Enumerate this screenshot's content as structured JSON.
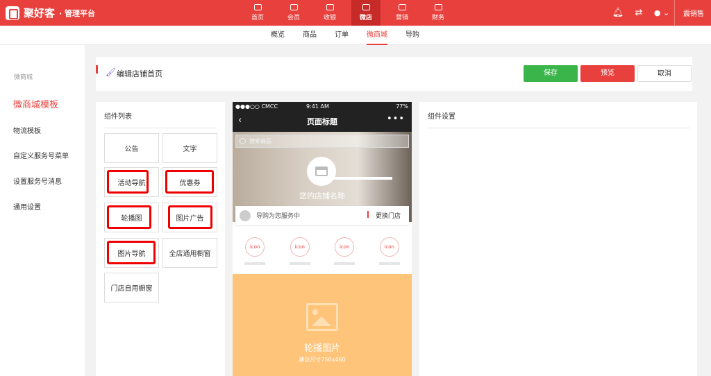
{
  "brand": {
    "name": "聚好客",
    "sub": "· 管理平台"
  },
  "topnav": [
    {
      "label": "首页",
      "icon": "home-icon"
    },
    {
      "label": "会员",
      "icon": "crown-icon"
    },
    {
      "label": "收银",
      "icon": "cashier-icon"
    },
    {
      "label": "微店",
      "icon": "shop-icon",
      "active": true
    },
    {
      "label": "营销",
      "icon": "box-icon"
    },
    {
      "label": "财务",
      "icon": "card-icon"
    }
  ],
  "topright": {
    "bell": "bell-icon",
    "settings": "sliders-icon",
    "user": "user-icon",
    "shop_label": "震销售"
  },
  "subnav": [
    {
      "label": "概览"
    },
    {
      "label": "商品"
    },
    {
      "label": "订单"
    },
    {
      "label": "微商城",
      "active": true
    },
    {
      "label": "导购"
    }
  ],
  "sidebar": {
    "title": "微商城",
    "items": [
      {
        "label": "微商城模板",
        "active": true
      },
      {
        "label": "物流模板"
      },
      {
        "label": "自定义服务号菜单"
      },
      {
        "label": "设置服务号消息"
      },
      {
        "label": "通用设置"
      }
    ]
  },
  "editbar": {
    "title": "编辑店铺首页",
    "save": "保存",
    "preview": "预览",
    "cancel": "取消"
  },
  "components": {
    "title": "组件列表",
    "items": [
      "公告",
      "文字",
      "活动导航",
      "优惠券",
      "轮播图",
      "图片广告",
      "图片导航",
      "全店通用橱窗",
      "门店自用橱窗"
    ]
  },
  "phone": {
    "carrier": "●●●○○ CMCC",
    "time": "9:41 AM",
    "battery": "77%",
    "page_title": "页面标题",
    "back": "‹",
    "more": "•••",
    "search_placeholder": "搜索商品",
    "store_name": "您的店铺名称",
    "guide_text": "导购为您服务中",
    "change_store": "更换门店",
    "icons": [
      "icon",
      "icon",
      "icon",
      "icon"
    ],
    "carousel_title": "轮播图片",
    "carousel_sub": "建议尺寸750x460"
  },
  "settings": {
    "title": "组件设置"
  },
  "colors": {
    "brand": "#e8413d",
    "save": "#3ab54a",
    "carousel": "#fec47a"
  }
}
